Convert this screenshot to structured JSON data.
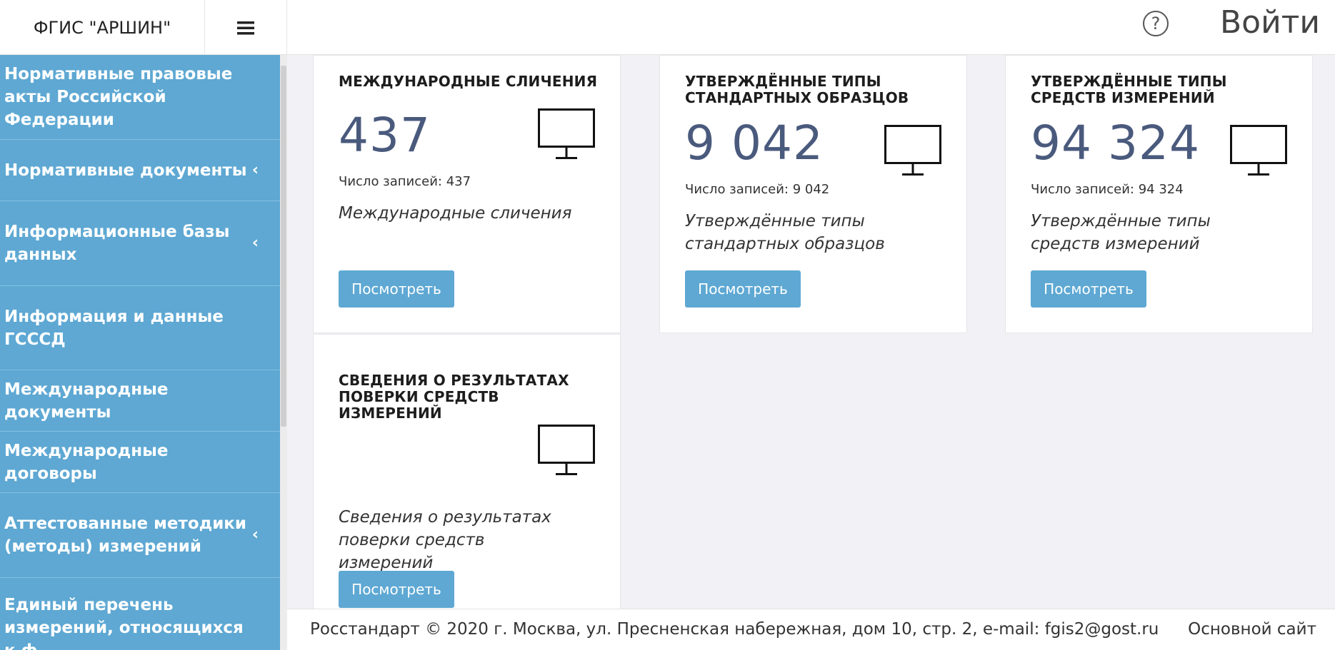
{
  "header": {
    "brand": "ФГИС \"АРШИН\"",
    "menu_icon": "hamburger-icon",
    "help_icon": "?",
    "login_label": "Войти"
  },
  "sidebar": {
    "items": [
      {
        "label": "Нормативные правовые акты Российской Федерации",
        "has_submenu": false
      },
      {
        "label": "Нормативные документы",
        "has_submenu": true
      },
      {
        "label": "Информационные базы данных",
        "has_submenu": true
      },
      {
        "label": "Информация и данные ГСССД",
        "has_submenu": false
      },
      {
        "label": "Международные документы",
        "has_submenu": false
      },
      {
        "label": "Международные договоры",
        "has_submenu": false
      },
      {
        "label": "Аттестованные методики (методы) измерений",
        "has_submenu": true
      },
      {
        "label": "Единый перечень измерений, относящихся к ф",
        "has_submenu": false
      }
    ],
    "chevron": "‹"
  },
  "cards": [
    {
      "title": "Международные сличения",
      "count": "437",
      "records": "Число записей: 437",
      "description": "Международные сличения",
      "button": "Посмотреть",
      "icon": "monitor-icon"
    },
    {
      "title": "Утверждённые типы стандартных образцов",
      "count": "9 042",
      "records": "Число записей: 9 042",
      "description": "Утверждённые типы стандартных образцов",
      "button": "Посмотреть",
      "icon": "monitor-icon"
    },
    {
      "title": "Утверждённые типы средств измерений",
      "count": "94 324",
      "records": "Число записей: 94 324",
      "description": "Утверждённые типы средств измерений",
      "button": "Посмотреть",
      "icon": "monitor-icon"
    },
    {
      "title": "Сведения о результатах поверки средств измерений",
      "description": "Сведения о результатах поверки средств измерений",
      "button": "Посмотреть",
      "icon": "monitor-icon"
    }
  ],
  "footer": {
    "copyright": "Росстандарт © 2020 г. Москва, ул. Пресненская набережная, дом 10, стр. 2, e-mail: fgis2@gost.ru",
    "main_site": "Основной сайт"
  },
  "colors": {
    "accent": "#5ea8d3",
    "count_text": "#4a5a7d",
    "page_bg": "#f2f2f6"
  }
}
